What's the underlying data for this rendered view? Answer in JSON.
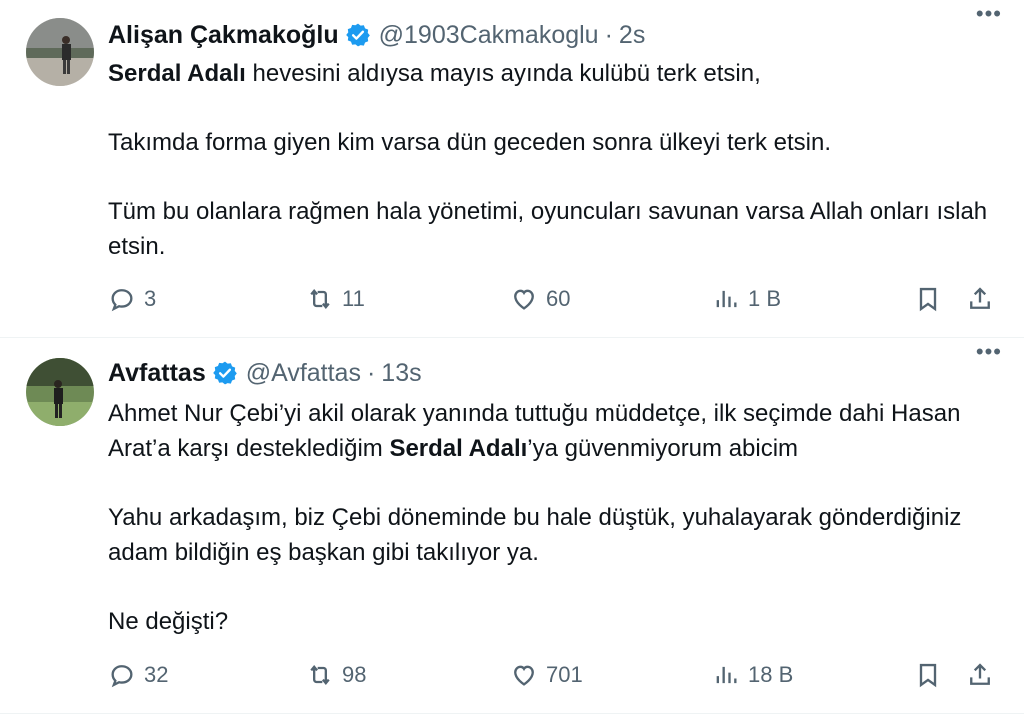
{
  "tweets": [
    {
      "author_name": "Alişan Çakmakoğlu",
      "handle": "@1903Cakmakoglu",
      "separator": "·",
      "time": "2s",
      "more": "•••",
      "paragraphs": [
        [
          {
            "t": "Serdal Adalı",
            "bold": true
          },
          {
            "t": " hevesini aldıysa mayıs ayında kulübü terk etsin,"
          }
        ],
        [
          {
            "t": "Takımda forma giyen kim varsa dün geceden sonra ülkeyi terk etsin."
          }
        ],
        [
          {
            "t": "Tüm bu olanlara rağmen hala yönetimi, oyuncuları savunan varsa Allah onları ıslah etsin."
          }
        ]
      ],
      "actions": {
        "replies": "3",
        "retweets": "11",
        "likes": "60",
        "views": "1 B"
      }
    },
    {
      "author_name": "Avfattas",
      "handle": "@Avfattas",
      "separator": "·",
      "time": "13s",
      "more": "•••",
      "paragraphs": [
        [
          {
            "t": "Ahmet Nur Çebi’yi akil olarak yanında tuttuğu müddetçe, ilk seçimde dahi Hasan Arat’a karşı desteklediğim "
          },
          {
            "t": "Serdal Adalı",
            "bold": true
          },
          {
            "t": "’ya güvenmiyorum abicim"
          }
        ],
        [
          {
            "t": "Yahu arkadaşım, biz Çebi döneminde bu hale düştük, yuhalayarak gönderdiğiniz adam bildiğin eş başkan gibi takılıyor ya."
          }
        ],
        [
          {
            "t": "Ne değişti?"
          }
        ]
      ],
      "actions": {
        "replies": "32",
        "retweets": "98",
        "likes": "701",
        "views": "18 B"
      }
    }
  ],
  "colors": {
    "verified": "#1d9bf0",
    "muted": "#536471",
    "text": "#0f1419",
    "divider": "#eff3f4"
  },
  "icons": [
    "verified-badge-icon",
    "more-icon",
    "reply-icon",
    "retweet-icon",
    "like-icon",
    "views-icon",
    "bookmark-icon",
    "share-icon"
  ]
}
